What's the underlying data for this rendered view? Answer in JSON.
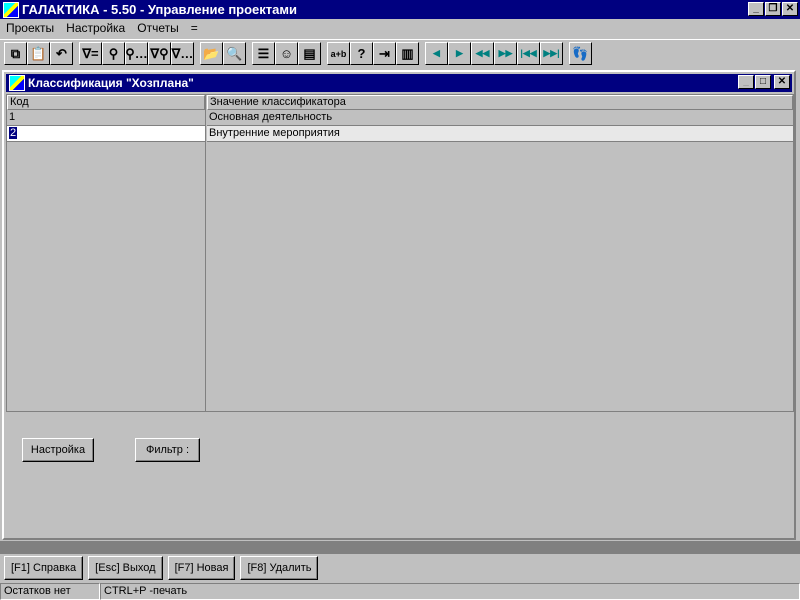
{
  "app": {
    "title": "ГАЛАКТИКА - 5.50 - Управление проектами"
  },
  "menu": [
    "Проекты",
    "Настройка",
    "Отчеты",
    "="
  ],
  "toolbar": [
    {
      "icon": "copy-icon",
      "g": "⧉"
    },
    {
      "icon": "paste-icon",
      "g": "📋"
    },
    {
      "icon": "undo-icon",
      "g": "↶"
    },
    "gap",
    {
      "icon": "filter-icon",
      "g": "∇="
    },
    {
      "icon": "find-icon",
      "g": "⚲"
    },
    {
      "icon": "find-more-icon",
      "g": "⚲…"
    },
    {
      "icon": "filter-find-icon",
      "g": "∇⚲"
    },
    {
      "icon": "filter-find-more-icon",
      "g": "∇…"
    },
    "gap",
    {
      "icon": "open-folder-icon",
      "g": "📂"
    },
    {
      "icon": "folder-search-icon",
      "g": "🔍"
    },
    "gap",
    {
      "icon": "numbered-list-icon",
      "g": "☰"
    },
    {
      "icon": "smiley-icon",
      "g": "☺"
    },
    {
      "icon": "form-icon",
      "g": "▤"
    },
    "gap",
    {
      "icon": "calculator-icon",
      "g": "a+b"
    },
    {
      "icon": "help-icon",
      "g": "?"
    },
    {
      "icon": "exit-door-icon",
      "g": "⇥"
    },
    {
      "icon": "document-icon",
      "g": "▥"
    },
    "gap",
    {
      "icon": "prev-icon",
      "g": "◀"
    },
    {
      "icon": "next-icon",
      "g": "▶"
    },
    {
      "icon": "page-prev-icon",
      "g": "◀◀"
    },
    {
      "icon": "page-next-icon",
      "g": "▶▶"
    },
    {
      "icon": "first-icon",
      "g": "|◀◀"
    },
    {
      "icon": "last-icon",
      "g": "▶▶|"
    },
    "gap",
    {
      "icon": "footprints-icon",
      "g": "👣"
    }
  ],
  "window": {
    "title": "Классификация \"Хозплана\""
  },
  "grid": {
    "headers": [
      "Код",
      "Значение классификатора"
    ],
    "rows": [
      [
        "1",
        "Основная деятельность"
      ],
      [
        "2",
        "Внутренние мероприятия"
      ]
    ]
  },
  "buttons": {
    "settings": "Настройка",
    "filter": "Фильтр :"
  },
  "fkeys": [
    "[F1] Справка",
    "[Esc] Выход",
    "[F7] Новая",
    "[F8] Удалить"
  ],
  "status": [
    "Остатков нет",
    "CTRL+P -печать"
  ]
}
